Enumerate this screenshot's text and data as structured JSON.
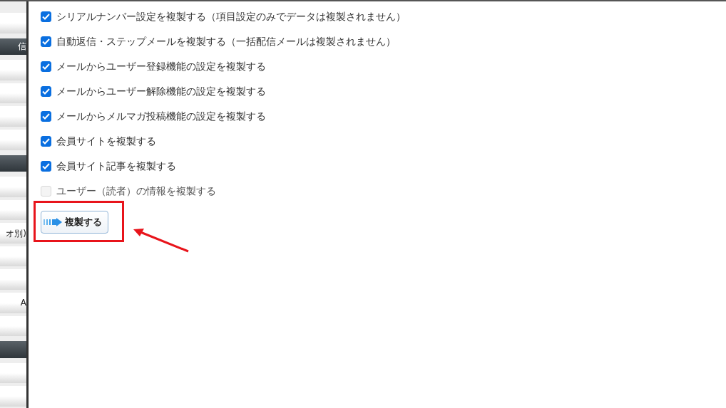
{
  "sidebar": {
    "items": [
      {
        "kind": "item"
      },
      {
        "kind": "header",
        "text": "信"
      },
      {
        "kind": "item"
      },
      {
        "kind": "item"
      },
      {
        "kind": "item"
      },
      {
        "kind": "item"
      },
      {
        "kind": "header"
      },
      {
        "kind": "item"
      },
      {
        "kind": "item"
      },
      {
        "kind": "item",
        "text": "オ別)"
      },
      {
        "kind": "item"
      },
      {
        "kind": "item"
      },
      {
        "kind": "item",
        "text": "A"
      },
      {
        "kind": "item"
      },
      {
        "kind": "header"
      },
      {
        "kind": "item"
      },
      {
        "kind": "item"
      }
    ]
  },
  "options": [
    {
      "label": "シリアルナンバー設定を複製する（項目設定のみでデータは複製されません）",
      "checked": true,
      "disabled": false
    },
    {
      "label": "自動返信・ステップメールを複製する（一括配信メールは複製されません）",
      "checked": true,
      "disabled": false
    },
    {
      "label": "メールからユーザー登録機能の設定を複製する",
      "checked": true,
      "disabled": false
    },
    {
      "label": "メールからユーザー解除機能の設定を複製する",
      "checked": true,
      "disabled": false
    },
    {
      "label": "メールからメルマガ投稿機能の設定を複製する",
      "checked": true,
      "disabled": false
    },
    {
      "label": "会員サイトを複製する",
      "checked": true,
      "disabled": false
    },
    {
      "label": "会員サイト記事を複製する",
      "checked": true,
      "disabled": false
    },
    {
      "label": "ユーザー（読者）の情報を複製する",
      "checked": false,
      "disabled": true
    }
  ],
  "submit_button": {
    "label": "複製する"
  }
}
